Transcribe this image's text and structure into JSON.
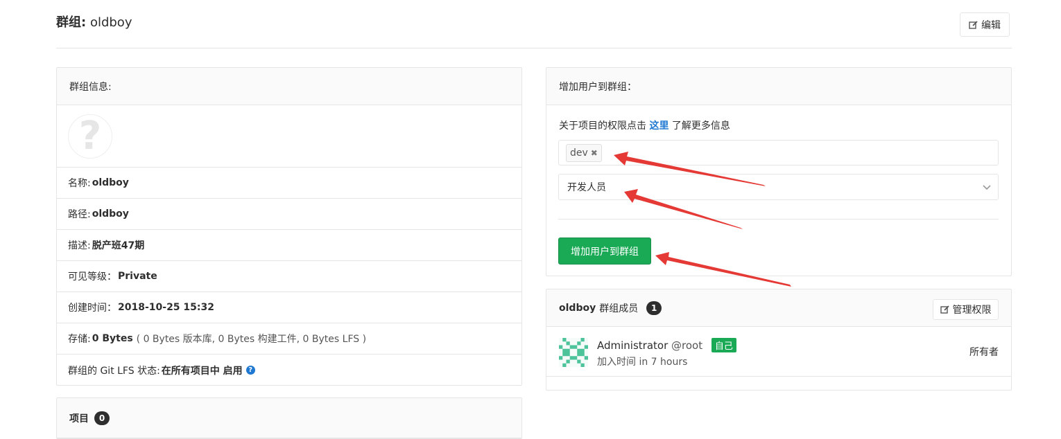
{
  "header": {
    "title_prefix": "群组:",
    "title_name": "oldboy",
    "edit_label": "编辑"
  },
  "group_info": {
    "heading": "群组信息:",
    "name_label": "名称:",
    "name_value": "oldboy",
    "path_label": "路径:",
    "path_value": "oldboy",
    "desc_label": "描述:",
    "desc_value": "脱产班47期",
    "visibility_label": "可见等级：",
    "visibility_value": "Private",
    "created_label": "创建时间：",
    "created_value": "2018-10-25 15:32",
    "storage_label": "存储:",
    "storage_value": "0 Bytes",
    "storage_detail": "( 0 Bytes 版本库, 0 Bytes 构建工件, 0 Bytes LFS )",
    "lfs_label": "群组的 Git LFS 状态:",
    "lfs_value": "在所有项目中 启用",
    "lfs_help_glyph": "?"
  },
  "projects": {
    "heading": "项目",
    "count": "0"
  },
  "add_user": {
    "heading": "增加用户到群组：",
    "hint_before": "关于项目的权限点击",
    "hint_link": "这里",
    "hint_after": "了解更多信息",
    "selected_user": "dev",
    "token_remove_glyph": "✖",
    "role_value": "开发人员",
    "submit_label": "增加用户到群组"
  },
  "members": {
    "group_name": "oldboy",
    "heading_suffix": "群组成员",
    "count": "1",
    "manage_label": "管理权限",
    "list": [
      {
        "name": "Administrator",
        "username": "@root",
        "self_badge": "自己",
        "joined": "加入时间 in 7 hours",
        "role": "所有者"
      }
    ]
  },
  "colors": {
    "accent_green": "#1aaa55",
    "link_blue": "#1f78d1",
    "annotation_red": "#e53935"
  },
  "icons": {
    "edit": "pencil-square-icon",
    "help": "question-circle-icon",
    "dropdown": "chevron-down-icon",
    "avatar_placeholder": "question-mark-avatar"
  }
}
